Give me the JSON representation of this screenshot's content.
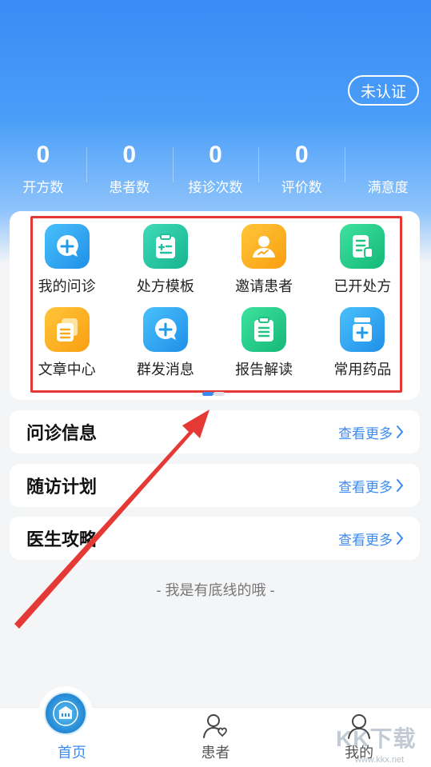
{
  "header": {
    "cert_label": "未认证"
  },
  "stats": [
    {
      "value": "0",
      "label": "开方数"
    },
    {
      "value": "0",
      "label": "患者数"
    },
    {
      "value": "0",
      "label": "接诊次数"
    },
    {
      "value": "0",
      "label": "评价数"
    },
    {
      "value": "",
      "label": "满意度"
    }
  ],
  "grid": {
    "items": [
      {
        "label": "我的问诊",
        "icon": "consult-chat-icon",
        "color": "#2ea8f2"
      },
      {
        "label": "处方模板",
        "icon": "prescription-clipboard-icon",
        "color": "#26c8a6"
      },
      {
        "label": "邀请患者",
        "icon": "invite-patient-icon",
        "color": "#fbb21e"
      },
      {
        "label": "已开处方",
        "icon": "issued-prescription-icon",
        "color": "#25c98a"
      },
      {
        "label": "文章中心",
        "icon": "article-docs-icon",
        "color": "#fbb21e"
      },
      {
        "label": "群发消息",
        "icon": "broadcast-message-icon",
        "color": "#2ea8f2"
      },
      {
        "label": "报告解读",
        "icon": "report-clipboard-icon",
        "color": "#25c98a"
      },
      {
        "label": "常用药品",
        "icon": "medicine-box-icon",
        "color": "#2ea8f2"
      }
    ]
  },
  "sections": [
    {
      "title": "问诊信息",
      "more": "查看更多"
    },
    {
      "title": "随访计划",
      "more": "查看更多"
    },
    {
      "title": "医生攻略",
      "more": "查看更多"
    }
  ],
  "footer_note": "- 我是有底线的哦 -",
  "tabbar": {
    "tabs": [
      {
        "label": "首页",
        "active": true
      },
      {
        "label": "患者",
        "active": false
      },
      {
        "label": "我的",
        "active": false
      }
    ]
  },
  "watermark": {
    "text": "KK下载",
    "url": "www.kkx.net"
  },
  "colors": {
    "brand": "#3a8bf5",
    "highlight": "#e53935"
  }
}
